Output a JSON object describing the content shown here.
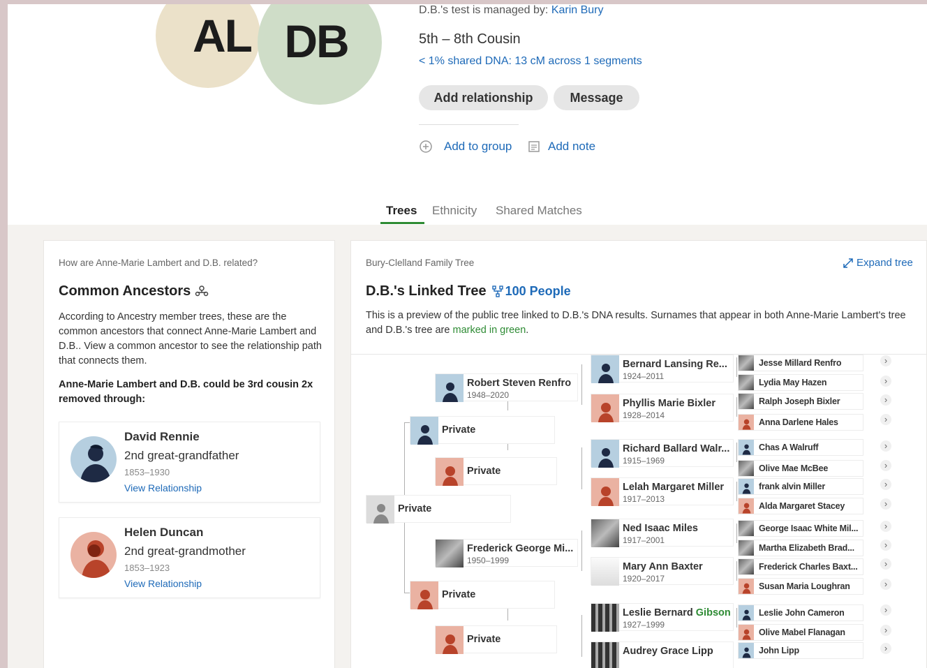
{
  "header": {
    "avatar_left_initials": "AL",
    "avatar_right_initials": "DB",
    "manager_prefix": "D.B.'s test is managed by:",
    "manager_name": "Karin Bury",
    "relationship": "5th – 8th Cousin",
    "shared_dna": "< 1% shared DNA: 13 cM across 1 segments",
    "add_relationship_label": "Add relationship",
    "message_label": "Message",
    "add_to_group_label": "Add to group",
    "add_note_label": "Add note"
  },
  "tabs": [
    {
      "label": "Trees",
      "active": true
    },
    {
      "label": "Ethnicity",
      "active": false
    },
    {
      "label": "Shared Matches",
      "active": false
    }
  ],
  "common_ancestors": {
    "question": "How are Anne-Marie Lambert and D.B. related?",
    "title": "Common Ancestors",
    "description": "According to Ancestry member trees, these are the common ancestors that connect Anne-Marie Lambert and D.B.. View a common ancestor to see the relationship path that connects them.",
    "summary": "Anne-Marie Lambert and D.B. could be 3rd cousin 2x removed through:",
    "people": [
      {
        "name": "David Rennie",
        "relation": "2nd great-grandfather",
        "years": "1853–1930",
        "link": "View Relationship"
      },
      {
        "name": "Helen Duncan",
        "relation": "2nd great-grandmother",
        "years": "1853–1923",
        "link": "View Relationship"
      }
    ]
  },
  "linked_tree": {
    "tree_name": "Bury-Clelland Family Tree",
    "expand_label": "Expand tree",
    "title": "D.B.'s Linked Tree",
    "people_count": "100 People",
    "desc_main": "This is a preview of the public tree linked to D.B.'s DNA results. Surnames that appear in both Anne-Marie Lambert's tree and D.B.'s tree are",
    "desc_green": "marked in green",
    "desc_end": ".",
    "root": {
      "name": "Private"
    },
    "parents": [
      {
        "name": "Private"
      },
      {
        "name": "Private"
      }
    ],
    "grandparents": [
      {
        "name": "Robert Steven Renfro",
        "years": "1948–2020"
      },
      {
        "name": "Private"
      },
      {
        "name": "Frederick George Mi...",
        "years": "1950–1999"
      },
      {
        "name": "Private"
      }
    ],
    "great_grandparents": [
      {
        "name": "Bernard Lansing Re...",
        "years": "1924–2011"
      },
      {
        "name": "Phyllis Marie Bixler",
        "years": "1928–2014"
      },
      {
        "name": "Richard Ballard Walr...",
        "years": "1915–1969"
      },
      {
        "name": "Lelah Margaret Miller",
        "years": "1917–2013"
      },
      {
        "name": "Ned Isaac Miles",
        "years": "1917–2001"
      },
      {
        "name": "Mary Ann Baxter",
        "years": "1920–2017"
      },
      {
        "name_first": "Leslie Bernard",
        "name_green": "Gibson",
        "years": "1927–1999"
      },
      {
        "name": "Audrey Grace Lipp"
      }
    ],
    "ancestors": [
      "Jesse Millard Renfro",
      "Lydia May Hazen",
      "Ralph Joseph Bixler",
      "Anna Darlene Hales",
      "Chas A Walruff",
      "Olive Mae McBee",
      "frank alvin Miller",
      "Alda Margaret Stacey",
      "George Isaac White Mil...",
      "Martha Elizabeth Brad...",
      "Frederick Charles Baxt...",
      "Susan Maria Loughran",
      "Leslie John Cameron",
      "Olive Mabel Flanagan",
      "John Lipp"
    ],
    "chevron": "›"
  },
  "colors": {
    "link": "#1e6ab8",
    "green": "#2e8b34",
    "avatar_left": "#ebe1c9",
    "avatar_right": "#cfddc8",
    "tab_underline": "#2e8b34",
    "male_photo": "#b6cfe0",
    "female_photo": "#eab2a2"
  }
}
